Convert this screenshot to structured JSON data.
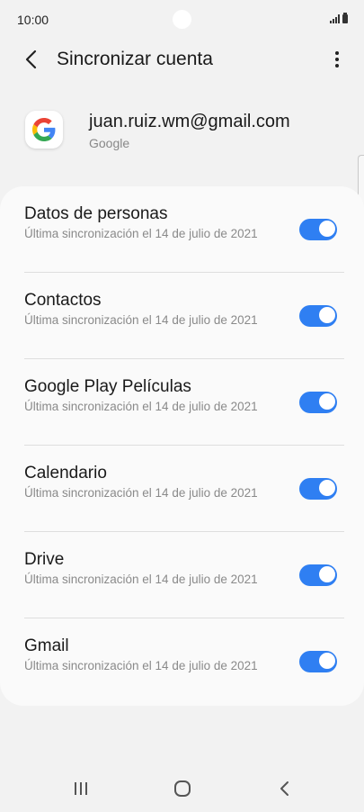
{
  "status_bar": {
    "time": "10:00"
  },
  "app_bar": {
    "title": "Sincronizar cuenta"
  },
  "account": {
    "email": "juan.ruiz.wm@gmail.com",
    "provider": "Google"
  },
  "sync_items": [
    {
      "label": "Datos de personas",
      "status": "Última sincronización el 14 de julio de 2021",
      "enabled": true
    },
    {
      "label": "Contactos",
      "status": "Última sincronización el 14 de julio de 2021",
      "enabled": true
    },
    {
      "label": "Google Play Películas",
      "status": "Última sincronización el 14 de julio de 2021",
      "enabled": true
    },
    {
      "label": "Calendario",
      "status": "Última sincronización el 14 de julio de 2021",
      "enabled": true
    },
    {
      "label": "Drive",
      "status": "Última sincronización el 14 de julio de 2021",
      "enabled": true
    },
    {
      "label": "Gmail",
      "status": "Última sincronización el 14 de julio de 2021",
      "enabled": true
    }
  ],
  "colors": {
    "accent": "#2f7ff2",
    "background": "#f2f2f2",
    "card": "#fafafa"
  },
  "icons": {
    "back": "chevron-left-icon",
    "more": "more-vert-icon",
    "account": "google-logo-icon",
    "nav_recents": "recents-icon",
    "nav_home": "home-icon",
    "nav_back": "back-icon"
  }
}
